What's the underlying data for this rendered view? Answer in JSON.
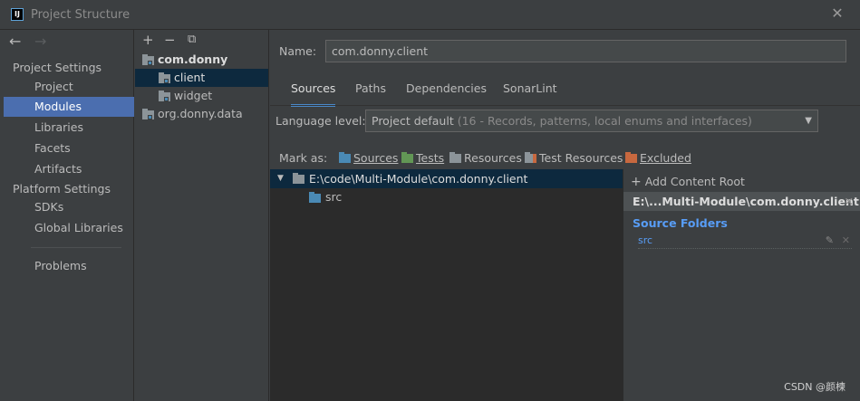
{
  "window": {
    "title": "Project Structure",
    "logo": "IJ",
    "close_glyph": "✕"
  },
  "nav": {
    "back": "←",
    "forward": "→",
    "project_settings_header": "Project Settings",
    "platform_settings_header": "Platform Settings",
    "items": [
      "Project",
      "Modules",
      "Libraries",
      "Facets",
      "Artifacts"
    ],
    "platform_items": [
      "SDKs",
      "Global Libraries"
    ],
    "problems": "Problems"
  },
  "tree": {
    "add": "+",
    "remove": "−",
    "copy": "⧉",
    "nodes": [
      {
        "label": "com.donny"
      },
      {
        "label": "client"
      },
      {
        "label": "widget"
      },
      {
        "label": "org.donny.data"
      }
    ]
  },
  "main": {
    "name_label": "Name:",
    "name_value": "com.donny.client",
    "tabs": [
      "Sources",
      "Paths",
      "Dependencies",
      "SonarLint"
    ],
    "language_label": "Language level:",
    "language_value": "Project default",
    "language_hint": "(16 - Records, patterns, local enums and interfaces)",
    "mark_as_label": "Mark as:",
    "mark_as": [
      {
        "label": "Sources",
        "color": "#4a8ab5"
      },
      {
        "label": "Tests",
        "color": "#629755"
      },
      {
        "label": "Resources",
        "color": "#8c9499"
      },
      {
        "label": "Test Resources",
        "color": "#8c9499"
      },
      {
        "label": "Excluded",
        "color": "#c7683f"
      }
    ],
    "content_root": "E:\\code\\Multi-Module\\com.donny.client",
    "source_child": "src",
    "add_content_root": "Add Content Root",
    "root_header": "E:\\...Multi-Module\\com.donny.client",
    "source_folders_title": "Source Folders",
    "source_folder": "src"
  },
  "watermark": "CSDN @颜楝",
  "colors": {
    "selection": "#4b6eaf",
    "tree_selection": "#0d293e",
    "link": "#589df6"
  }
}
